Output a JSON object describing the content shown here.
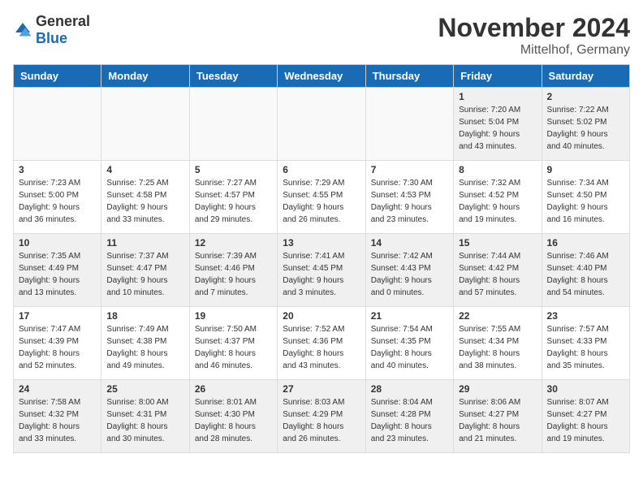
{
  "header": {
    "logo_general": "General",
    "logo_blue": "Blue",
    "month_year": "November 2024",
    "location": "Mittelhof, Germany"
  },
  "days_of_week": [
    "Sunday",
    "Monday",
    "Tuesday",
    "Wednesday",
    "Thursday",
    "Friday",
    "Saturday"
  ],
  "weeks": [
    [
      {
        "day": "",
        "detail": ""
      },
      {
        "day": "",
        "detail": ""
      },
      {
        "day": "",
        "detail": ""
      },
      {
        "day": "",
        "detail": ""
      },
      {
        "day": "",
        "detail": ""
      },
      {
        "day": "1",
        "detail": "Sunrise: 7:20 AM\nSunset: 5:04 PM\nDaylight: 9 hours\nand 43 minutes."
      },
      {
        "day": "2",
        "detail": "Sunrise: 7:22 AM\nSunset: 5:02 PM\nDaylight: 9 hours\nand 40 minutes."
      }
    ],
    [
      {
        "day": "3",
        "detail": "Sunrise: 7:23 AM\nSunset: 5:00 PM\nDaylight: 9 hours\nand 36 minutes."
      },
      {
        "day": "4",
        "detail": "Sunrise: 7:25 AM\nSunset: 4:58 PM\nDaylight: 9 hours\nand 33 minutes."
      },
      {
        "day": "5",
        "detail": "Sunrise: 7:27 AM\nSunset: 4:57 PM\nDaylight: 9 hours\nand 29 minutes."
      },
      {
        "day": "6",
        "detail": "Sunrise: 7:29 AM\nSunset: 4:55 PM\nDaylight: 9 hours\nand 26 minutes."
      },
      {
        "day": "7",
        "detail": "Sunrise: 7:30 AM\nSunset: 4:53 PM\nDaylight: 9 hours\nand 23 minutes."
      },
      {
        "day": "8",
        "detail": "Sunrise: 7:32 AM\nSunset: 4:52 PM\nDaylight: 9 hours\nand 19 minutes."
      },
      {
        "day": "9",
        "detail": "Sunrise: 7:34 AM\nSunset: 4:50 PM\nDaylight: 9 hours\nand 16 minutes."
      }
    ],
    [
      {
        "day": "10",
        "detail": "Sunrise: 7:35 AM\nSunset: 4:49 PM\nDaylight: 9 hours\nand 13 minutes."
      },
      {
        "day": "11",
        "detail": "Sunrise: 7:37 AM\nSunset: 4:47 PM\nDaylight: 9 hours\nand 10 minutes."
      },
      {
        "day": "12",
        "detail": "Sunrise: 7:39 AM\nSunset: 4:46 PM\nDaylight: 9 hours\nand 7 minutes."
      },
      {
        "day": "13",
        "detail": "Sunrise: 7:41 AM\nSunset: 4:45 PM\nDaylight: 9 hours\nand 3 minutes."
      },
      {
        "day": "14",
        "detail": "Sunrise: 7:42 AM\nSunset: 4:43 PM\nDaylight: 9 hours\nand 0 minutes."
      },
      {
        "day": "15",
        "detail": "Sunrise: 7:44 AM\nSunset: 4:42 PM\nDaylight: 8 hours\nand 57 minutes."
      },
      {
        "day": "16",
        "detail": "Sunrise: 7:46 AM\nSunset: 4:40 PM\nDaylight: 8 hours\nand 54 minutes."
      }
    ],
    [
      {
        "day": "17",
        "detail": "Sunrise: 7:47 AM\nSunset: 4:39 PM\nDaylight: 8 hours\nand 52 minutes."
      },
      {
        "day": "18",
        "detail": "Sunrise: 7:49 AM\nSunset: 4:38 PM\nDaylight: 8 hours\nand 49 minutes."
      },
      {
        "day": "19",
        "detail": "Sunrise: 7:50 AM\nSunset: 4:37 PM\nDaylight: 8 hours\nand 46 minutes."
      },
      {
        "day": "20",
        "detail": "Sunrise: 7:52 AM\nSunset: 4:36 PM\nDaylight: 8 hours\nand 43 minutes."
      },
      {
        "day": "21",
        "detail": "Sunrise: 7:54 AM\nSunset: 4:35 PM\nDaylight: 8 hours\nand 40 minutes."
      },
      {
        "day": "22",
        "detail": "Sunrise: 7:55 AM\nSunset: 4:34 PM\nDaylight: 8 hours\nand 38 minutes."
      },
      {
        "day": "23",
        "detail": "Sunrise: 7:57 AM\nSunset: 4:33 PM\nDaylight: 8 hours\nand 35 minutes."
      }
    ],
    [
      {
        "day": "24",
        "detail": "Sunrise: 7:58 AM\nSunset: 4:32 PM\nDaylight: 8 hours\nand 33 minutes."
      },
      {
        "day": "25",
        "detail": "Sunrise: 8:00 AM\nSunset: 4:31 PM\nDaylight: 8 hours\nand 30 minutes."
      },
      {
        "day": "26",
        "detail": "Sunrise: 8:01 AM\nSunset: 4:30 PM\nDaylight: 8 hours\nand 28 minutes."
      },
      {
        "day": "27",
        "detail": "Sunrise: 8:03 AM\nSunset: 4:29 PM\nDaylight: 8 hours\nand 26 minutes."
      },
      {
        "day": "28",
        "detail": "Sunrise: 8:04 AM\nSunset: 4:28 PM\nDaylight: 8 hours\nand 23 minutes."
      },
      {
        "day": "29",
        "detail": "Sunrise: 8:06 AM\nSunset: 4:27 PM\nDaylight: 8 hours\nand 21 minutes."
      },
      {
        "day": "30",
        "detail": "Sunrise: 8:07 AM\nSunset: 4:27 PM\nDaylight: 8 hours\nand 19 minutes."
      }
    ]
  ]
}
